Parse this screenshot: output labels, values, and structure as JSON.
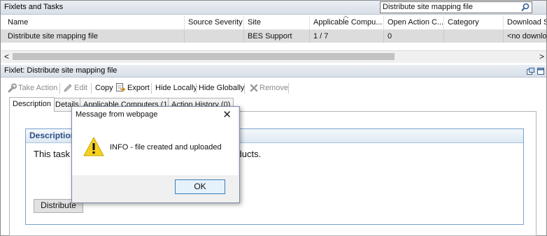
{
  "top_panel": {
    "title": "Fixlets and Tasks",
    "search_value": "Distribute site mapping file",
    "columns": [
      "Name",
      "Source Severity",
      "Site",
      "Applicable Compu...",
      "Open Action C...",
      "Category",
      "Download S"
    ],
    "rows": [
      [
        "Distribute site mapping file",
        "",
        "BES Support",
        "1 / 7",
        "0",
        "",
        "<no downlo"
      ]
    ],
    "scroll_left": "<",
    "scroll_right": ">"
  },
  "detail_panel": {
    "title": "Fixlet: Distribute site mapping file",
    "toolbar": {
      "take_action": "Take Action",
      "edit": "Edit",
      "copy": "Copy",
      "export": "Export",
      "hide_locally": "Hide Locally",
      "hide_globally": "Hide Globally",
      "remove": "Remove"
    },
    "tabs": [
      "Description",
      "Details",
      "Applicable Computers (1)",
      "Action History (0)"
    ],
    "description": {
      "header": "Description",
      "text_start": "This task",
      "text_end": "roducts.",
      "button": "Distribute"
    }
  },
  "dialog": {
    "title": "Message from webpage",
    "close": "✕",
    "message": "INFO - file created and uploaded",
    "ok": "OK",
    "warning_color": "#f6d21e"
  },
  "colors": {
    "selected_row": "#dcdcdc",
    "header_gradient_top": "#eaeef4",
    "desc_header_text": "#2a4f85"
  }
}
